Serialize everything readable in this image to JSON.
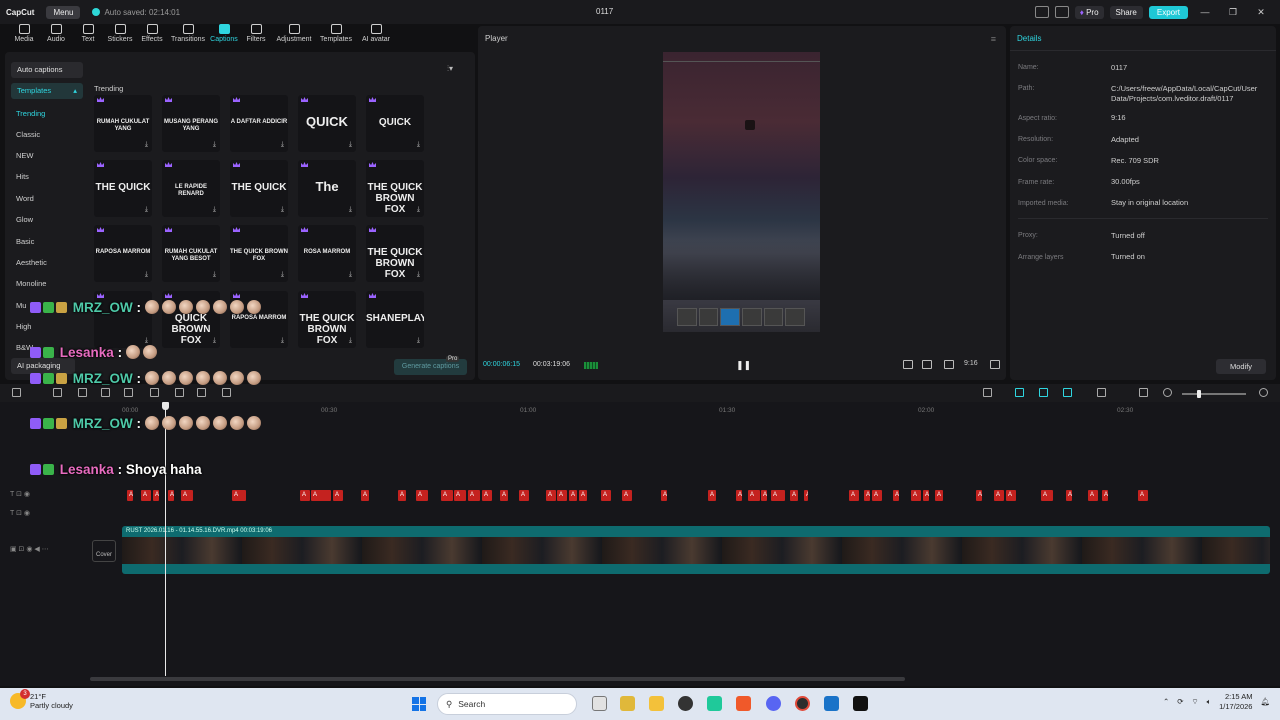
{
  "titlebar": {
    "app_name": "CapCut",
    "menu_label": "Menu",
    "autosave_text": "Auto saved: 02:14:01",
    "project_title": "0117",
    "pro_label": "Pro",
    "share_label": "Share",
    "export_label": "Export"
  },
  "toolbar": {
    "items": [
      "Media",
      "Audio",
      "Text",
      "Stickers",
      "Effects",
      "Transitions",
      "Captions",
      "Filters",
      "Adjustment",
      "Templates",
      "AI avatar"
    ],
    "active": "Captions"
  },
  "captions_panel": {
    "auto_captions_label": "Auto captions",
    "templates_label": "Templates",
    "categories": [
      "Trending",
      "Classic",
      "NEW",
      "Hits",
      "Word",
      "Glow",
      "Basic",
      "Aesthetic",
      "Monoline",
      "Mu",
      "High",
      "B&W"
    ],
    "ai_packaging_label": "AI packaging",
    "section_label": "Trending",
    "tiles": [
      {
        "text": "RUMAH CUKULAT YANG",
        "style": "small"
      },
      {
        "text": "MUSANG PERANG YANG",
        "style": "small"
      },
      {
        "text": "A DAFTAR ADDICIR",
        "style": "small"
      },
      {
        "text": "QUICK",
        "style": "big"
      },
      {
        "text": "QUICK",
        "style": "mid"
      },
      {
        "text": "THE QUICK",
        "style": "mid"
      },
      {
        "text": "LE RAPIDE RENARD",
        "style": "small"
      },
      {
        "text": "THE QUICK",
        "style": "mid"
      },
      {
        "text": "The",
        "style": "big"
      },
      {
        "text": "THE QUICK BROWN FOX",
        "style": "mid"
      },
      {
        "text": "RAPOSA MARROM",
        "style": "small"
      },
      {
        "text": "RUMAH CUKULAT YANG BESOT",
        "style": "small"
      },
      {
        "text": "THE QUICK BROWN FOX",
        "style": "small"
      },
      {
        "text": "ROSA MARROM",
        "style": "small"
      },
      {
        "text": "THE QUICK BROWN FOX",
        "style": "mid"
      },
      {
        "text": "",
        "style": "small"
      },
      {
        "text": "QUICK BROWN FOX",
        "style": "mid"
      },
      {
        "text": "RAPOSA MARROM",
        "style": "small"
      },
      {
        "text": "THE QUICK BROWN FOX",
        "style": "mid"
      },
      {
        "text": "SHANEPLAYS",
        "style": "mid"
      }
    ],
    "generate_label": "Generate captions",
    "generate_badge": "Pro"
  },
  "player": {
    "title": "Player",
    "current_time": "00:00:06:15",
    "total_time": "00:03:19:06",
    "ratio_label": "9:16"
  },
  "details": {
    "title": "Details",
    "rows": [
      {
        "label": "Name:",
        "value": "0117"
      },
      {
        "label": "Path:",
        "value": "C:/Users/freew/AppData/Local/CapCut/User Data/Projects/com.lveditor.draft/0117"
      },
      {
        "label": "Aspect ratio:",
        "value": "9:16"
      },
      {
        "label": "Resolution:",
        "value": "Adapted"
      },
      {
        "label": "Color space:",
        "value": "Rec. 709 SDR"
      },
      {
        "label": "Frame rate:",
        "value": "30.00fps"
      },
      {
        "label": "Imported media:",
        "value": "Stay in original location"
      },
      {
        "label": "Proxy:",
        "value": "Turned off"
      },
      {
        "label": "Arrange layers",
        "value": "Turned on"
      }
    ],
    "modify_label": "Modify"
  },
  "timeline": {
    "ruler": [
      "00:00",
      "00:30",
      "01:00",
      "01:30",
      "02:00",
      "02:30"
    ],
    "video_clip_label": "RUST 2026.01.16 - 01.14.55.16.DVR.mp4   00:03:19:06",
    "cover_label": "Cover",
    "caption_clip_text": "A"
  },
  "chat_overlay": [
    {
      "name": "MRZ_OW",
      "color": "#4ec9a8",
      "message": ":",
      "emotes": 7
    },
    {
      "name": "Lesanka",
      "color": "#e86cc0",
      "message": ":",
      "emotes": 2
    },
    {
      "name": "MRZ_OW",
      "color": "#4ec9a8",
      "message": ":",
      "emotes": 7
    },
    {
      "name": "MRZ_OW",
      "color": "#4ec9a8",
      "message": ":",
      "emotes": 7
    },
    {
      "name": "Lesanka",
      "color": "#e86cc0",
      "message": ": Shoya haha",
      "emotes": 0
    }
  ],
  "taskbar": {
    "weather_temp": "21°F",
    "weather_desc": "Partly cloudy",
    "weather_badge": "3",
    "search_placeholder": "Search",
    "time": "2:15 AM",
    "date": "1/17/2026"
  }
}
